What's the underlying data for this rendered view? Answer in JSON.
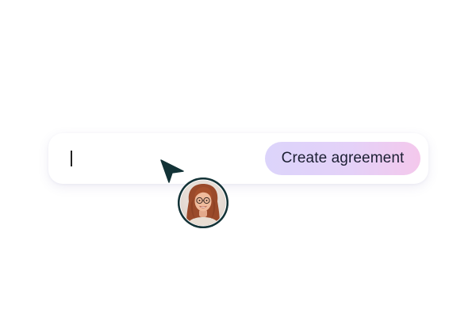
{
  "input": {
    "value": "",
    "placeholder": ""
  },
  "actions": {
    "create_label": "Create agreement"
  },
  "cursor": {
    "icon": "pointer-arrow-icon",
    "color": "#133337"
  },
  "collaborator": {
    "avatar_icon": "user-avatar-photo",
    "ring_color": "#133337"
  },
  "colors": {
    "button_gradient_start": "#dcd4fb",
    "button_gradient_end": "#f4c8ec",
    "button_text": "#1c1f33"
  }
}
